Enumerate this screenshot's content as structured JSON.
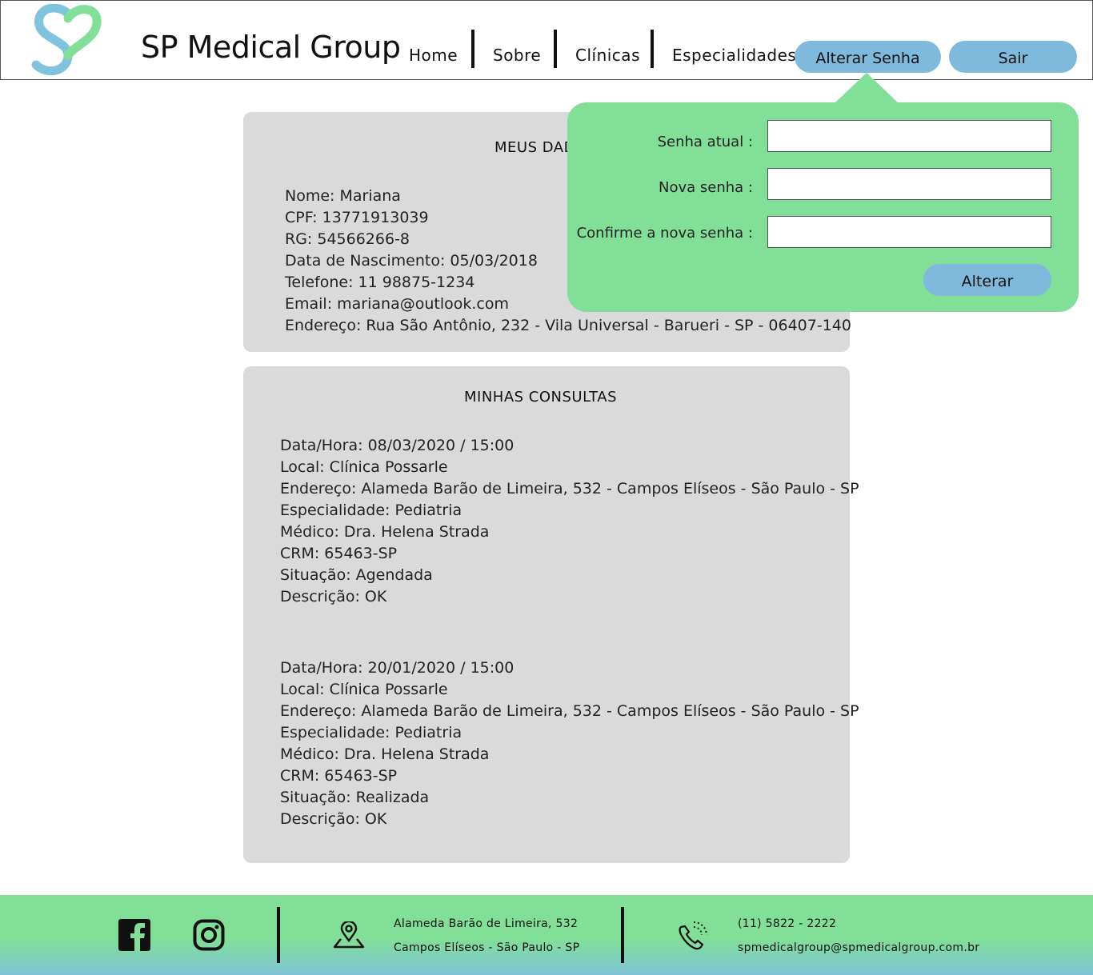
{
  "header": {
    "brand": "SP Medical Group",
    "nav": [
      "Home",
      "Sobre",
      "Clínicas",
      "Especialidades"
    ],
    "change_password_label": "Alterar Senha",
    "logout_label": "Sair"
  },
  "profile": {
    "title": "MEUS DADOS",
    "fields": [
      "Nome: Mariana",
      "CPF: 13771913039",
      "RG: 54566266-8",
      "Data de Nascimento: 05/03/2018",
      "Telefone: 11 98875-1234",
      "Email: mariana@outlook.com",
      "Endereço: Rua São Antônio, 232 - Vila Universal - Barueri - SP - 06407-140"
    ]
  },
  "appointments": {
    "title": "MINHAS CONSULTAS",
    "items": [
      {
        "datetime": "Data/Hora: 08/03/2020 / 15:00",
        "local": "Local: Clínica Possarle",
        "address": "Endereço: Alameda Barão de Limeira, 532 - Campos Elíseos - São Paulo - SP",
        "specialty": "Especialidade: Pediatria",
        "doctor": "Médico: Dra. Helena Strada",
        "crm": "CRM: 65463-SP",
        "status": "Situação: Agendada",
        "description": "Descrição: OK"
      },
      {
        "datetime": "Data/Hora: 20/01/2020 / 15:00",
        "local": "Local: Clínica Possarle",
        "address": "Endereço: Alameda Barão de Limeira, 532 - Campos Elíseos - São Paulo - SP",
        "specialty": "Especialidade: Pediatria",
        "doctor": "Médico: Dra. Helena Strada",
        "crm": "CRM: 65463-SP",
        "status": "Situação: Realizada",
        "description": "Descrição: OK"
      }
    ]
  },
  "password_popover": {
    "current_label": "Senha atual :",
    "new_label": "Nova senha :",
    "confirm_label": "Confirme a nova senha :",
    "current_value": "",
    "new_value": "",
    "confirm_value": "",
    "submit_label": "Alterar"
  },
  "footer": {
    "address_line1": "Alameda Barão de Limeira, 532",
    "address_line2": "Campos Elíseos - São Paulo - SP",
    "phone": "(11) 5822 - 2222",
    "email": "spmedicalgroup@spmedicalgroup.com.br",
    "icons": [
      "facebook-icon",
      "instagram-icon",
      "map-pin-icon",
      "phone-icon"
    ]
  },
  "colors": {
    "accent_blue": "#7fb9dc",
    "accent_green": "#82df98",
    "card_gray": "#dadada"
  }
}
